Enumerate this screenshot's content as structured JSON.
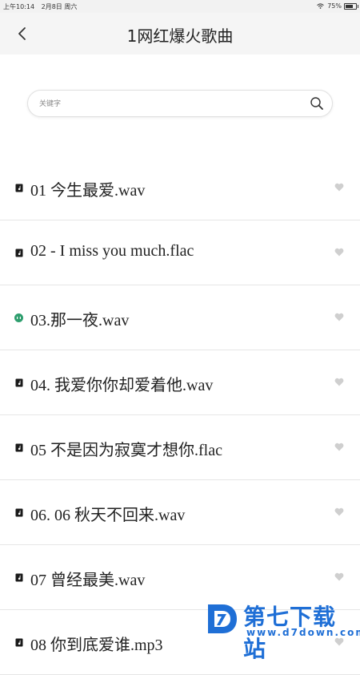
{
  "statusbar": {
    "time": "上午10:14",
    "date": "2月8日 周六",
    "battery": "75%",
    "battery_level": 0.75
  },
  "header": {
    "title": "1网红爆火歌曲",
    "back_icon": "chevron-left-icon"
  },
  "search": {
    "placeholder": "关键字",
    "value": "",
    "icon": "search-icon"
  },
  "songs": [
    {
      "name": "01 今生最爱.wav",
      "icon": "music-file-icon",
      "playing": false
    },
    {
      "name": "02 - I miss you much.flac",
      "icon": "music-file-icon",
      "playing": false
    },
    {
      "name": "03.那一夜.wav",
      "icon": "playing-indicator-icon",
      "playing": true
    },
    {
      "name": "04. 我爱你你却爱着他.wav",
      "icon": "music-file-icon",
      "playing": false
    },
    {
      "name": "05 不是因为寂寞才想你.flac",
      "icon": "music-file-icon",
      "playing": false
    },
    {
      "name": "06. 06 秋天不回来.wav",
      "icon": "music-file-icon",
      "playing": false
    },
    {
      "name": "07 曾经最美.wav",
      "icon": "music-file-icon",
      "playing": false
    },
    {
      "name": "08 你到底爱谁.mp3",
      "icon": "music-file-icon",
      "playing": false
    }
  ],
  "watermark": {
    "title": "第七下载站",
    "url": "www.d7down.com"
  },
  "colors": {
    "accent_playing": "#2e9e6e",
    "watermark": "#1f6fd6",
    "navbar_bg": "#f5f5f5",
    "heart": "#cfcfcf"
  }
}
